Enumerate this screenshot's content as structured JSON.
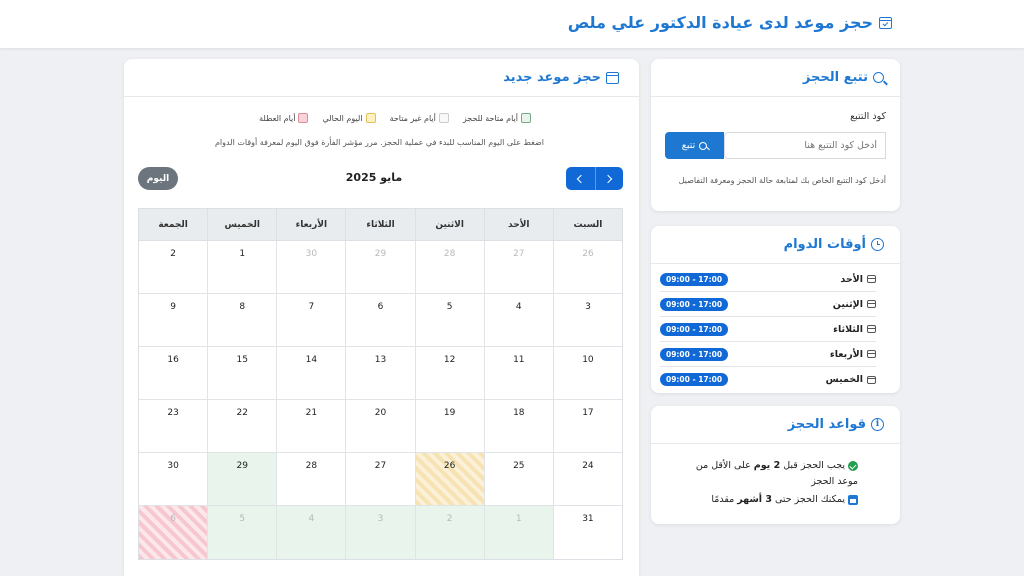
{
  "site": {
    "title": "حجز موعد لدى عيادة الدكتور علي ملص"
  },
  "track": {
    "title": "تتبع الحجز",
    "code_label": "كود التتبع",
    "input_placeholder": "أدخل كود التتبع هنا",
    "button_label": "تتبع",
    "hint": "أدخل كود التتبع الخاص بك لمتابعة حالة الحجز ومعرفة التفاصيل"
  },
  "hours": {
    "title": "أوقات الدوام",
    "rows": [
      {
        "day": "الأحد",
        "time": "09:00 - 17:00"
      },
      {
        "day": "الإثنين",
        "time": "09:00 - 17:00"
      },
      {
        "day": "الثلاثاء",
        "time": "09:00 - 17:00"
      },
      {
        "day": "الأربعاء",
        "time": "09:00 - 17:00"
      },
      {
        "day": "الخميس",
        "time": "09:00 - 17:00"
      }
    ]
  },
  "rules": {
    "title": "قواعد الحجز",
    "rule1_pre": "يجب الحجز قبل ",
    "rule1_bold": "2 يوم",
    "rule1_post": " على الأقل من موعد الحجز",
    "rule2_pre": "يمكنك الحجز حتى ",
    "rule2_bold": "3 أشهر",
    "rule2_post": " مقدمًا"
  },
  "booking": {
    "title": "حجز موعد جديد",
    "legend": {
      "available": "أيام متاحة للحجز",
      "unavailable": "أيام غير متاحة",
      "today": "اليوم الحالي",
      "holiday": "أيام العطلة"
    },
    "instructions": "اضغط على اليوم المناسب للبدء في عملية الحجز. مرر مؤشر الفأرة فوق اليوم لمعرفة أوقات الدوام",
    "month_title": "مايو 2025",
    "today_label": "اليوم",
    "weekdays": [
      "السبت",
      "الأحد",
      "الاثنين",
      "الثلاثاء",
      "الأربعاء",
      "الخميس",
      "الجمعة"
    ],
    "weeks": [
      [
        {
          "d": "26",
          "s": "other"
        },
        {
          "d": "27",
          "s": "other"
        },
        {
          "d": "28",
          "s": "other"
        },
        {
          "d": "29",
          "s": "other"
        },
        {
          "d": "30",
          "s": "other"
        },
        {
          "d": "1",
          "s": ""
        },
        {
          "d": "2",
          "s": ""
        }
      ],
      [
        {
          "d": "3",
          "s": ""
        },
        {
          "d": "4",
          "s": ""
        },
        {
          "d": "5",
          "s": ""
        },
        {
          "d": "6",
          "s": ""
        },
        {
          "d": "7",
          "s": ""
        },
        {
          "d": "8",
          "s": ""
        },
        {
          "d": "9",
          "s": ""
        }
      ],
      [
        {
          "d": "10",
          "s": ""
        },
        {
          "d": "11",
          "s": ""
        },
        {
          "d": "12",
          "s": ""
        },
        {
          "d": "13",
          "s": ""
        },
        {
          "d": "14",
          "s": ""
        },
        {
          "d": "15",
          "s": ""
        },
        {
          "d": "16",
          "s": ""
        }
      ],
      [
        {
          "d": "17",
          "s": ""
        },
        {
          "d": "18",
          "s": ""
        },
        {
          "d": "19",
          "s": ""
        },
        {
          "d": "20",
          "s": ""
        },
        {
          "d": "21",
          "s": ""
        },
        {
          "d": "22",
          "s": ""
        },
        {
          "d": "23",
          "s": ""
        }
      ],
      [
        {
          "d": "24",
          "s": ""
        },
        {
          "d": "25",
          "s": ""
        },
        {
          "d": "26",
          "s": "current"
        },
        {
          "d": "27",
          "s": ""
        },
        {
          "d": "28",
          "s": ""
        },
        {
          "d": "29",
          "s": "available"
        },
        {
          "d": "30",
          "s": ""
        }
      ],
      [
        {
          "d": "31",
          "s": ""
        },
        {
          "d": "1",
          "s": "other available"
        },
        {
          "d": "2",
          "s": "other available"
        },
        {
          "d": "3",
          "s": "other available"
        },
        {
          "d": "4",
          "s": "other available"
        },
        {
          "d": "5",
          "s": "other available"
        },
        {
          "d": "6",
          "s": "other holiday"
        }
      ]
    ]
  },
  "colors": {
    "primary": "#1e78d2",
    "button": "#1169d8",
    "available": "#e8f4ec",
    "today": "#f7e2b3",
    "holiday": "#f6c7cf"
  }
}
